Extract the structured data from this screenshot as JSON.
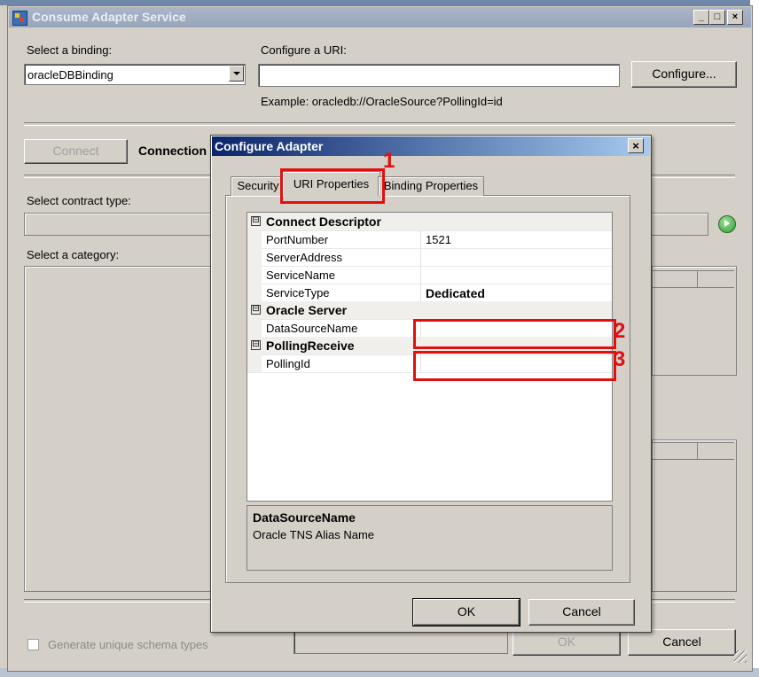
{
  "main_window": {
    "title": "Consume Adapter Service",
    "select_binding_label": "Select a binding:",
    "binding_value": "oracleDBBinding",
    "configure_uri_label": "Configure a URI:",
    "uri_value": "",
    "configure_button": "Configure...",
    "example_text": "Example: oracledb://OracleSource?PollingId=id",
    "connect_button": "Connect",
    "connection_label": "Connection",
    "contract_type_label": "Select contract type:",
    "category_label": "Select a category:",
    "generate_unique_label": "Generate unique schema types",
    "ok_button": "OK",
    "cancel_button": "Cancel"
  },
  "dialog": {
    "title": "Configure Adapter",
    "close_glyph": "×",
    "tabs": [
      {
        "label": "Security"
      },
      {
        "label": "URI Properties"
      },
      {
        "label": "Binding Properties"
      }
    ],
    "categories": [
      {
        "label": "Connect Descriptor",
        "toggle": "⊟"
      },
      {
        "label": "Oracle Server",
        "toggle": "⊟"
      },
      {
        "label": "PollingReceive",
        "toggle": "⊟"
      }
    ],
    "properties": [
      {
        "name": "PortNumber",
        "value": "1521"
      },
      {
        "name": "ServerAddress",
        "value": ""
      },
      {
        "name": "ServiceName",
        "value": ""
      },
      {
        "name": "ServiceType",
        "value": "Dedicated"
      },
      {
        "name": "DataSourceName",
        "value": ""
      },
      {
        "name": "PollingId",
        "value": ""
      }
    ],
    "description_title": "DataSourceName",
    "description_text": "Oracle TNS Alias Name",
    "ok_button": "OK",
    "cancel_button": "Cancel"
  },
  "annotations": {
    "callout_1": "1",
    "callout_2": "2",
    "callout_3": "3",
    "color": "#e01010"
  }
}
